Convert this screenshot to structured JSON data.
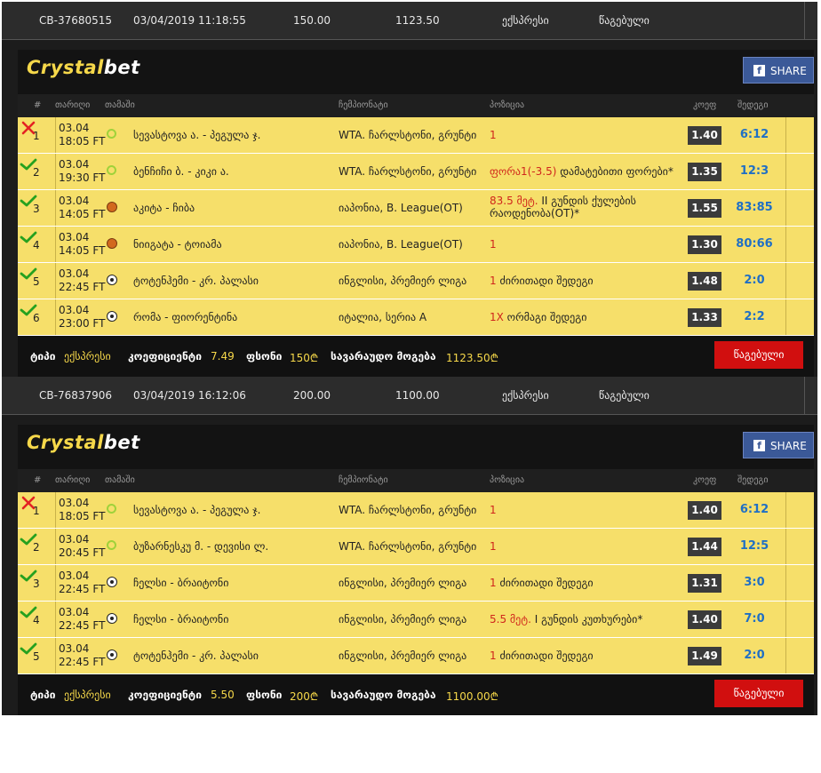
{
  "logo": {
    "part1": "Crystal",
    "part2": "bet"
  },
  "share_label": "SHARE",
  "fb_glyph": "f",
  "columns": {
    "num": "#",
    "date": "თარიღი",
    "game": "თამაში",
    "championship": "ჩემპიონატი",
    "position": "პოზიცია",
    "odds": "კოეფ",
    "result": "შედეგი"
  },
  "coupons": [
    {
      "id": "CB-37680515",
      "datetime": "03/04/2019 11:18:55",
      "stake": "150.00",
      "payout": "1123.50",
      "type": "ექსპრესი",
      "status": "წაგებული",
      "rows": [
        {
          "num": "1",
          "date": "03.04",
          "time": "18:05 FT",
          "sport": "tennis-icon",
          "match": "სევასტოვა ა. - პეგულა ჯ.",
          "league": "WTA. ჩარლსტონი, გრუნტი",
          "pos_red": "1",
          "pos_black": "",
          "pos_red2": "",
          "pos_black2": "",
          "odd": "1.40",
          "score": "6:12",
          "result": "lost"
        },
        {
          "num": "2",
          "date": "03.04",
          "time": "19:30 FT",
          "sport": "tennis-icon",
          "match": "ბენჩიჩი ბ. - კიკი ა.",
          "league": "WTA. ჩარლსტონი, გრუნტი",
          "pos_red": "ფორა1(-3.5)",
          "pos_black": " დამატებითი ფორები*",
          "pos_red2": "",
          "pos_black2": "",
          "odd": "1.35",
          "score": "12:3",
          "result": "won"
        },
        {
          "num": "3",
          "date": "03.04",
          "time": "14:05 FT",
          "sport": "basketball-icon",
          "match": "აკიტა - ჩიბა",
          "league": "იაპონია, B. League(OT)",
          "pos_red": "83.5 მეტ.",
          "pos_black": " II გუნდის ქულების",
          "pos_red2": "",
          "pos_black2": "რაოდენობა(OT)*",
          "odd": "1.55",
          "score": "83:85",
          "result": "won"
        },
        {
          "num": "4",
          "date": "03.04",
          "time": "14:05 FT",
          "sport": "basketball-icon",
          "match": "ნიიგატა - ტოიამა",
          "league": "იაპონია, B. League(OT)",
          "pos_red": "1",
          "pos_black": "",
          "pos_red2": "",
          "pos_black2": "",
          "odd": "1.30",
          "score": "80:66",
          "result": "won"
        },
        {
          "num": "5",
          "date": "03.04",
          "time": "22:45 FT",
          "sport": "soccer-icon",
          "match": "ტოტენჰემი - კრ. პალასი",
          "league": "ინგლისი, პრემიერ ლიგა",
          "pos_red": "1",
          "pos_black": " ძირითადი შედეგი",
          "pos_red2": "",
          "pos_black2": "",
          "odd": "1.48",
          "score": "2:0",
          "result": "won"
        },
        {
          "num": "6",
          "date": "03.04",
          "time": "23:00 FT",
          "sport": "soccer-icon",
          "match": "რომა - ფიორენტინა",
          "league": "იტალია, სერია A",
          "pos_red": "1X",
          "pos_black": " ორმაგი შედეგი",
          "pos_red2": "",
          "pos_black2": "",
          "odd": "1.33",
          "score": "2:2",
          "result": "won"
        }
      ],
      "footer": {
        "type_label": "ტიპი",
        "type_value": "ექსპრესი",
        "coef_label": "კოეფიციენტი",
        "coef_value": "7.49",
        "stake_label": "ფსონი",
        "stake_value": "150₾",
        "win_label": "სავარაუდო მოგება",
        "win_value": "1123.50₾",
        "button": "წაგებული"
      }
    },
    {
      "id": "CB-76837906",
      "datetime": "03/04/2019 16:12:06",
      "stake": "200.00",
      "payout": "1100.00",
      "type": "ექსპრესი",
      "status": "წაგებული",
      "rows": [
        {
          "num": "1",
          "date": "03.04",
          "time": "18:05 FT",
          "sport": "tennis-icon",
          "match": "სევასტოვა ა. - პეგულა ჯ.",
          "league": "WTA. ჩარლსტონი, გრუნტი",
          "pos_red": "1",
          "pos_black": "",
          "pos_red2": "",
          "pos_black2": "",
          "odd": "1.40",
          "score": "6:12",
          "result": "lost"
        },
        {
          "num": "2",
          "date": "03.04",
          "time": "20:45 FT",
          "sport": "tennis-icon",
          "match": "ბუზარნესკუ მ. - დევისი ლ.",
          "league": "WTA. ჩარლსტონი, გრუნტი",
          "pos_red": "1",
          "pos_black": "",
          "pos_red2": "",
          "pos_black2": "",
          "odd": "1.44",
          "score": "12:5",
          "result": "won"
        },
        {
          "num": "3",
          "date": "03.04",
          "time": "22:45 FT",
          "sport": "soccer-icon",
          "match": "ჩელსი - ბრაიტონი",
          "league": "ინგლისი, პრემიერ ლიგა",
          "pos_red": "1",
          "pos_black": " ძირითადი შედეგი",
          "pos_red2": "",
          "pos_black2": "",
          "odd": "1.31",
          "score": "3:0",
          "result": "won"
        },
        {
          "num": "4",
          "date": "03.04",
          "time": "22:45 FT",
          "sport": "soccer-icon",
          "match": "ჩელსი - ბრაიტონი",
          "league": "ინგლისი, პრემიერ ლიგა",
          "pos_red": "5.5 მეტ.",
          "pos_black": " I გუნდის კუთხურები*",
          "pos_red2": "",
          "pos_black2": "",
          "odd": "1.40",
          "score": "7:0",
          "result": "won"
        },
        {
          "num": "5",
          "date": "03.04",
          "time": "22:45 FT",
          "sport": "soccer-icon",
          "match": "ტოტენჰემი - კრ. პალასი",
          "league": "ინგლისი, პრემიერ ლიგა",
          "pos_red": "1",
          "pos_black": " ძირითადი შედეგი",
          "pos_red2": "",
          "pos_black2": "",
          "odd": "1.49",
          "score": "2:0",
          "result": "won"
        }
      ],
      "footer": {
        "type_label": "ტიპი",
        "type_value": "ექსპრესი",
        "coef_label": "კოეფიციენტი",
        "coef_value": "5.50",
        "stake_label": "ფსონი",
        "stake_value": "200₾",
        "win_label": "სავარაუდო მოგება",
        "win_value": "1100.00₾",
        "button": "წაგებული"
      }
    }
  ]
}
